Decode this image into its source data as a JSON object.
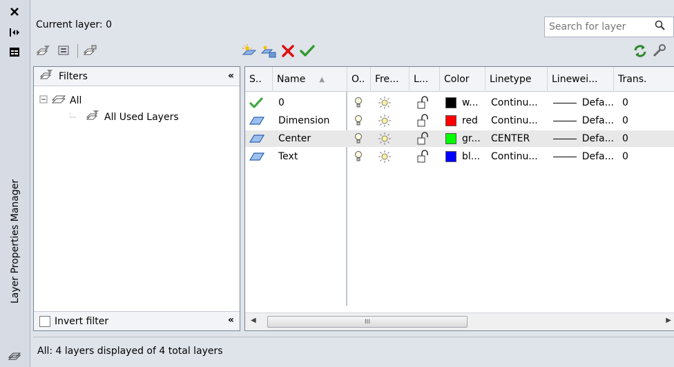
{
  "palette_title": "Layer Properties Manager",
  "current_layer_text": "Current layer: 0",
  "search": {
    "placeholder": "Search for layer"
  },
  "filters": {
    "header": "Filters",
    "tree": [
      {
        "label": "All",
        "level": 0
      },
      {
        "label": "All Used Layers",
        "level": 1
      }
    ],
    "invert_label": "Invert filter"
  },
  "columns": [
    "S..",
    "Name",
    "O..",
    "Fre...",
    "L...",
    "Color",
    "Linetype",
    "Linewei...",
    "Trans."
  ],
  "layers": [
    {
      "status": "current",
      "name": "0",
      "color_name": "w...",
      "color_hex": "#000000",
      "linetype": "Continu...",
      "lineweight": "Defa...",
      "transparency": "0",
      "selected": false
    },
    {
      "status": "layer",
      "name": "Dimension",
      "color_name": "red",
      "color_hex": "#ff0000",
      "linetype": "Continu...",
      "lineweight": "Defa...",
      "transparency": "0",
      "selected": false
    },
    {
      "status": "layer",
      "name": "Center",
      "color_name": "gr...",
      "color_hex": "#00ff00",
      "linetype": "CENTER",
      "lineweight": "Defa...",
      "transparency": "0",
      "selected": true
    },
    {
      "status": "layer",
      "name": "Text",
      "color_name": "bl...",
      "color_hex": "#0000ff",
      "linetype": "Continu...",
      "lineweight": "Defa...",
      "transparency": "0",
      "selected": false
    }
  ],
  "scrollbar_thumb": "III",
  "status_text": "All: 4 layers displayed of 4 total layers",
  "icons": {
    "new_layer": "sun-new-icon",
    "new_vp_frozen": "new-vp-frozen-icon",
    "delete_layer": "red-x-icon",
    "set_current": "green-check-icon",
    "refresh": "refresh-icon",
    "settings": "wrench-icon",
    "on": "lightbulb-icon",
    "freeze": "sun-icon",
    "lock": "padlock-open-icon"
  }
}
